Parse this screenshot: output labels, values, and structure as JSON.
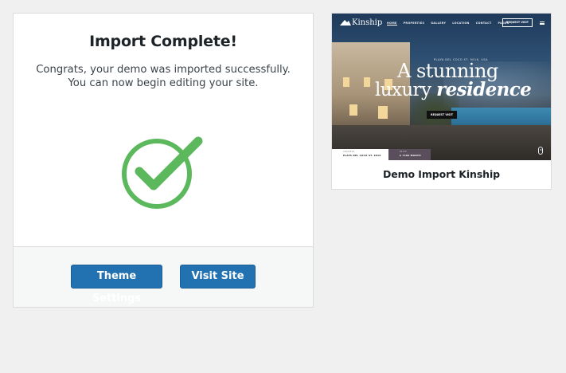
{
  "import": {
    "title": "Import Complete!",
    "message": "Congrats, your demo was imported successfully. You can now begin editing your site.",
    "theme_settings_label": "Theme Settings",
    "visit_site_label": "Visit Site",
    "success_color": "#5cb85c",
    "button_color": "#2271b1"
  },
  "preview": {
    "brand": "Kinship",
    "nav_items": [
      "HOME",
      "PROPERTIES",
      "GALLERY",
      "LOCATION",
      "CONTACT",
      "PAGES"
    ],
    "nav_cta": "REQUEST VISIT",
    "eyebrow": "PLAYA DEL COCO ST. 9016, USA",
    "headline_1": "A stunning",
    "headline_2_plain": "luxury",
    "headline_2_emph": "residence",
    "hero_button": "REQUEST VISIT",
    "address_label": "ADDRESS",
    "address_value": "PLAYA DEL COCO ST. 9016",
    "price_label": "PRICE",
    "price_value": "$ 7400 MONTH",
    "caption": "Demo Import Kinship"
  },
  "icons": [
    "check-circle-icon",
    "logo-mountain-icon",
    "menu-icon",
    "mouse-scroll-icon"
  ]
}
